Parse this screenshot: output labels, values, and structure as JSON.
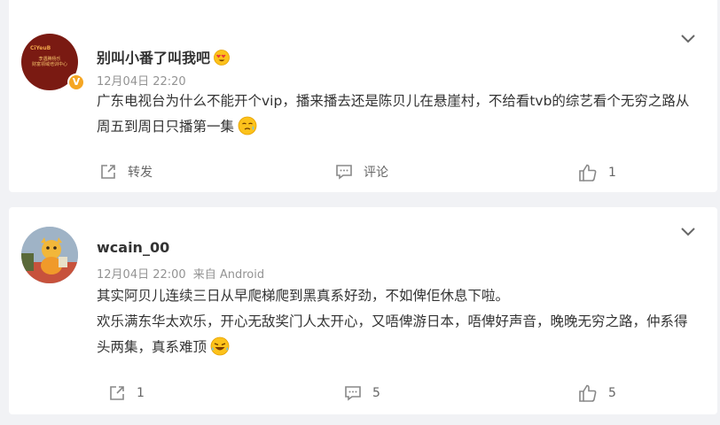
{
  "posts": [
    {
      "username": "别叫小番了叫我吧",
      "username_emoji": "heart-eyes-emoji",
      "verified_badge": "V",
      "avatar_text": {
        "brand": "CiYeuB",
        "line1": "李遇腾杨乐",
        "line2": "财富领域培训中心"
      },
      "time": "12月04日 22:20",
      "source": "",
      "content": "广东电视台为什么不能开个vip，播来播去还是陈贝儿在悬崖村，不给看tvb的综艺看个无穷之路从周五到周日只播第一集",
      "content_emoji": "sweat-emoji",
      "actions": {
        "repost": "转发",
        "comment": "评论",
        "like": "1"
      }
    },
    {
      "username": "wcain_00",
      "time": "12月04日 22:00",
      "source": "来自 Android",
      "content_line1": "其实阿贝儿连续三日从早爬梯爬到黑真系好劲，不如俾佢休息下啦。",
      "content_line2": "欢乐满东华太欢乐，开心无敌奖门人太开心，又唔俾游日本，唔俾好声音，晚晚无穷之路，仲系得头两集，真系难顶",
      "content_emoji": "laugh-cry-emoji",
      "actions": {
        "repost": "1",
        "comment": "5",
        "like": "5"
      }
    }
  ],
  "colors": {
    "background": "#f1f2f5",
    "card": "#ffffff",
    "meta": "#939393",
    "icon": "#888888",
    "badge": "#f5a623"
  }
}
